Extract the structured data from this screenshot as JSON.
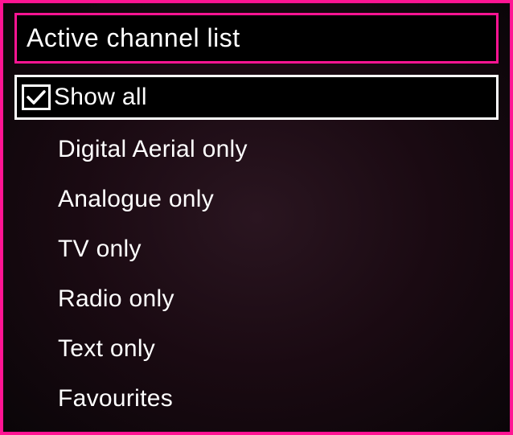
{
  "title": "Active channel list",
  "menu": {
    "items": [
      {
        "label": "Show all",
        "selected": true,
        "checked": true
      },
      {
        "label": "Digital Aerial only",
        "selected": false,
        "checked": false
      },
      {
        "label": "Analogue only",
        "selected": false,
        "checked": false
      },
      {
        "label": "TV only",
        "selected": false,
        "checked": false
      },
      {
        "label": "Radio only",
        "selected": false,
        "checked": false
      },
      {
        "label": "Text only",
        "selected": false,
        "checked": false
      },
      {
        "label": "Favourites",
        "selected": false,
        "checked": false
      }
    ]
  }
}
